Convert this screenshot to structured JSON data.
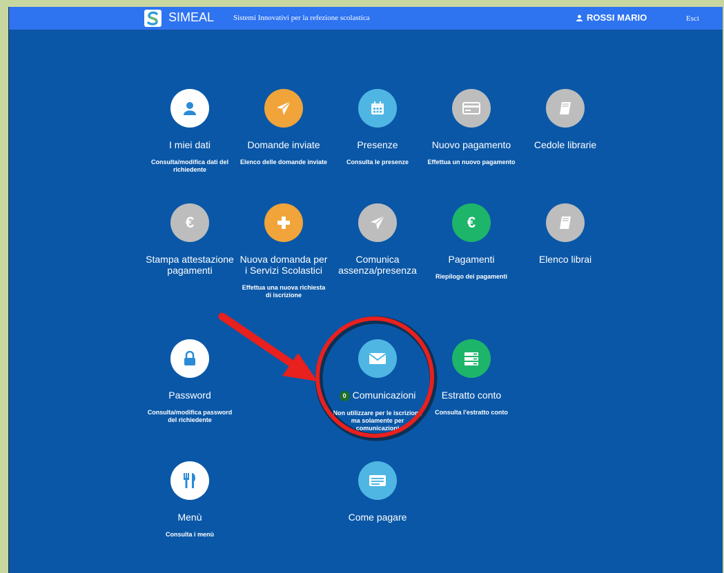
{
  "header": {
    "brand": "SIMEAL",
    "tagline": "Sistemi Innovativi per la refezione scolastica",
    "user_name": "ROSSI MARIO",
    "logout_label": "Esci"
  },
  "tiles": [
    {
      "title": "I miei dati",
      "desc": "Consulta/modifica dati del richiedente",
      "icon": "user-icon",
      "color": "#ffffff"
    },
    {
      "title": "Domande inviate",
      "desc": "Elenco delle domande inviate",
      "icon": "paper-plane-icon",
      "color": "#f0a43a"
    },
    {
      "title": "Presenze",
      "desc": "Consulta le presenze",
      "icon": "calendar-icon",
      "color": "#4fb6e3"
    },
    {
      "title": "Nuovo pagamento",
      "desc": "Effettua un nuovo pagamento",
      "icon": "credit-card-icon",
      "color": "#bdbdbd"
    },
    {
      "title": "Cedole librarie",
      "desc": "",
      "icon": "book-icon",
      "color": "#bdbdbd"
    },
    {
      "title": "Stampa attestazione pagamenti",
      "desc": "",
      "icon": "euro-icon",
      "color": "#bdbdbd"
    },
    {
      "title": "Nuova domanda per i Servizi Scolastici",
      "desc": "Effettua una nuova richiesta di iscrizione",
      "icon": "plus-icon",
      "color": "#f0a43a"
    },
    {
      "title": "Comunica assenza/presenza",
      "desc": "",
      "icon": "paper-plane-icon",
      "color": "#bdbdbd"
    },
    {
      "title": "Pagamenti",
      "desc": "Riepilogo dei pagamenti",
      "icon": "euro-icon",
      "color": "#1db56a"
    },
    {
      "title": "Elenco librai",
      "desc": "",
      "icon": "book-icon",
      "color": "#bdbdbd"
    },
    {
      "title": "Password",
      "desc": "Consulta/modifica password del richiedente",
      "icon": "lock-icon",
      "color": "#ffffff"
    },
    {
      "title": "Comunicazioni",
      "badge": "0",
      "desc": "Non utilizzare per le iscrizioni, ma solamente per comunicazioni",
      "icon": "envelope-icon",
      "color": "#4fb6e3"
    },
    {
      "title": "Estratto conto",
      "desc": "Consulta l'estratto conto",
      "icon": "list-icon",
      "color": "#1db56a"
    },
    {
      "title": "Menù",
      "desc": "Consulta i menù",
      "icon": "cutlery-icon",
      "color": "#ffffff"
    },
    {
      "title": "Come pagare",
      "desc": "",
      "icon": "card-list-icon",
      "color": "#4fb6e3"
    }
  ],
  "annotation": {
    "arrow_color": "#e8201e",
    "circle_color": "#e8201e"
  }
}
